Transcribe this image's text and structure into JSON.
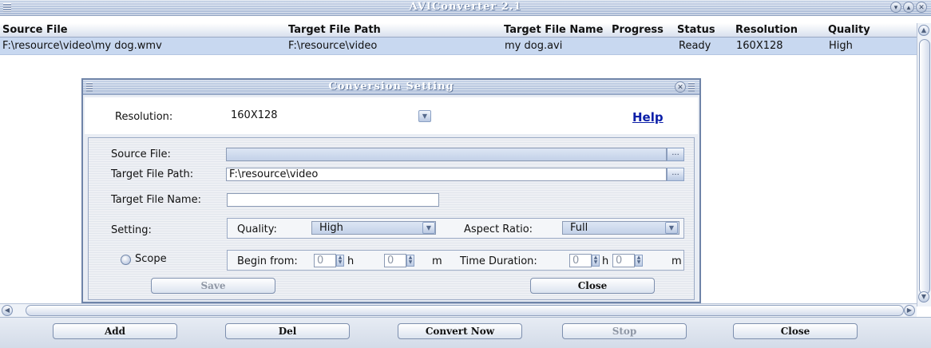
{
  "window": {
    "title": "AVIConverter 2.1",
    "controls": [
      "minimize-icon",
      "maximize-icon",
      "close-icon"
    ]
  },
  "table": {
    "columns": [
      "Source File",
      "Target File Path",
      "Target File Name",
      "Progress",
      "Status",
      "Resolution",
      "Quality"
    ],
    "rows": [
      {
        "source": "F:\\resource\\video\\my dog.wmv",
        "target_path": "F:\\resource\\video",
        "target_name": "my dog.avi",
        "progress": "",
        "status": "Ready",
        "resolution": "160X128",
        "quality": "High"
      }
    ]
  },
  "dialog": {
    "title": "Conversion Setting",
    "resolution_label": "Resolution:",
    "resolution_value": "160X128",
    "help_label": "Help",
    "source_label": "Source File:",
    "source_value": "",
    "target_path_label": "Target File Path:",
    "target_path_value": "F:\\resource\\video",
    "target_name_label": "Target File Name:",
    "target_name_value": "",
    "setting_label": "Setting:",
    "quality_label": "Quality:",
    "quality_value": "High",
    "aspect_label": "Aspect Ratio:",
    "aspect_value": "Full",
    "scope_label": "Scope",
    "begin_label": "Begin from:",
    "begin_h": "0",
    "h_unit": "h",
    "begin_m": "0",
    "m_unit": "m",
    "duration_label": "Time Duration:",
    "duration_h": "0",
    "duration_m": "0",
    "save_label": "Save",
    "close_label": "Close",
    "browse_glyph": "..."
  },
  "toolbar": {
    "add_label": "Add",
    "del_label": "Del",
    "convert_label": "Convert Now",
    "stop_label": "Stop",
    "close_label": "Close"
  },
  "colors": {
    "selected_row": "#c8d8f0",
    "title_gradient_top": "#c9d5e8",
    "link": "#0b1fa8"
  }
}
